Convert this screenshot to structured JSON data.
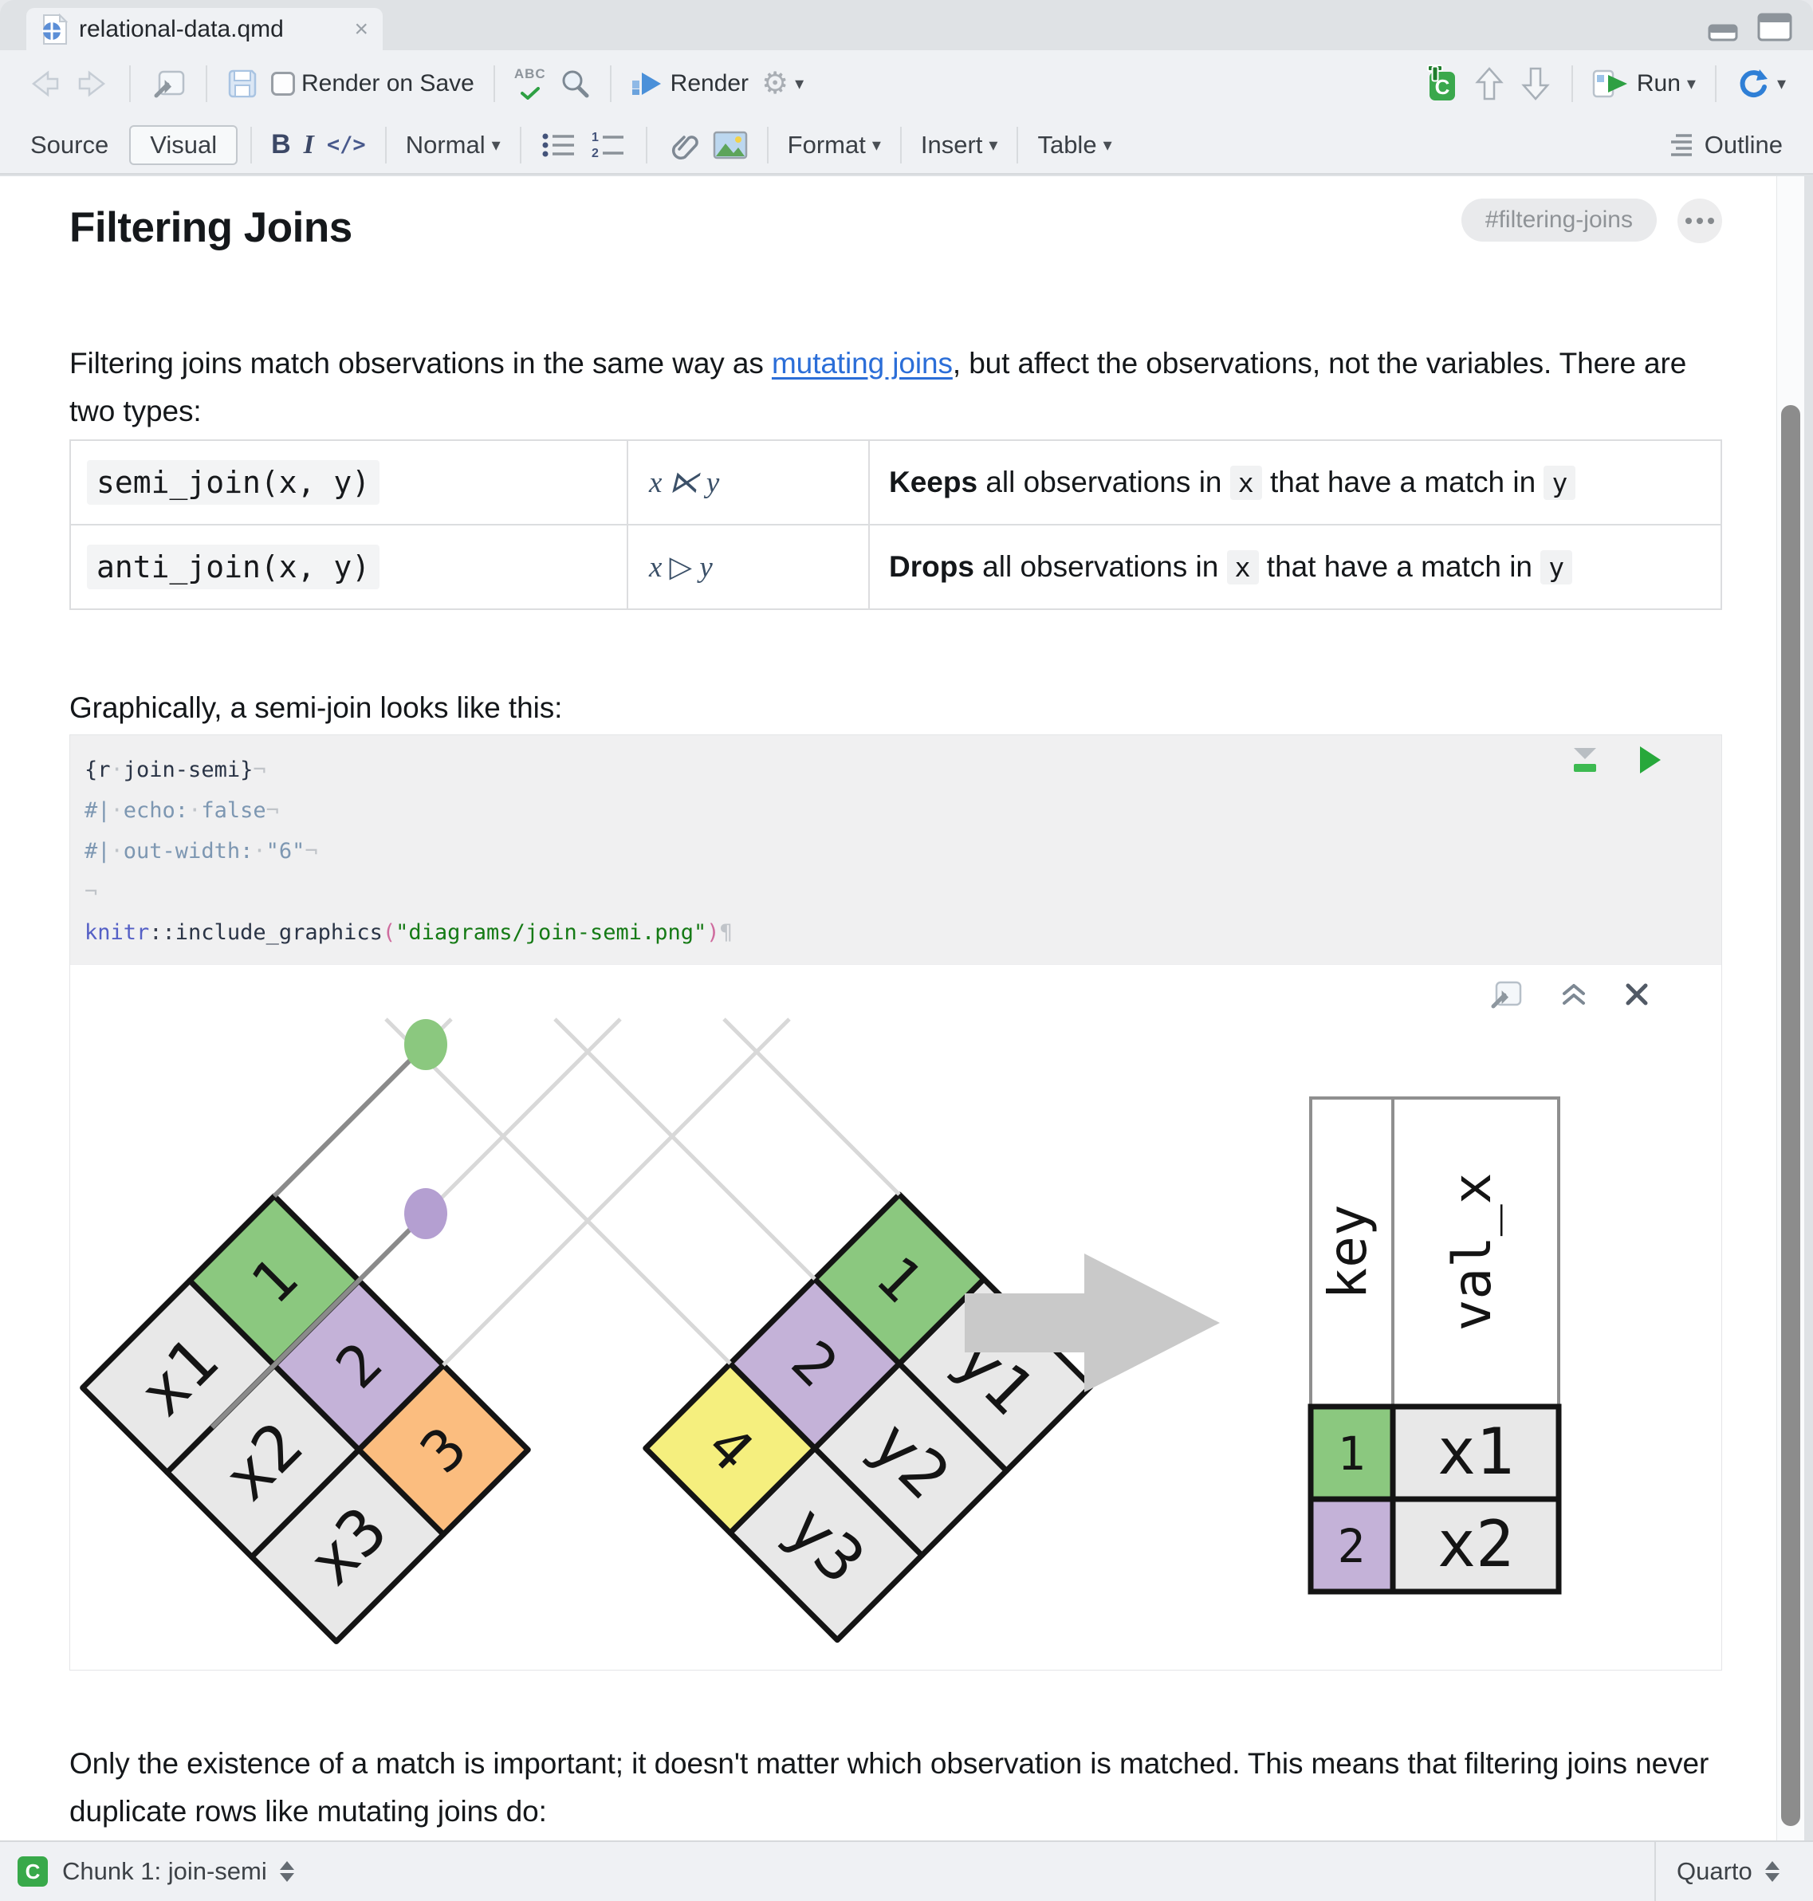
{
  "window": {
    "tab_title": "relational-data.qmd",
    "close_icon": "×"
  },
  "toolbar": {
    "render_on_save": "Render on Save",
    "spell_abc": "ABC",
    "render": "Render",
    "run": "Run",
    "caret": "▾"
  },
  "formatbar": {
    "source": "Source",
    "visual": "Visual",
    "bold": "B",
    "italic": "I",
    "code": "</>",
    "block_format": "Normal",
    "format_menu": "Format",
    "insert_menu": "Insert",
    "table_menu": "Table",
    "outline": "Outline"
  },
  "doc": {
    "heading": "Filtering Joins",
    "section_badge": "#filtering-joins",
    "para1_pre": "Filtering joins match observations in the same way as ",
    "para1_link": "mutating joins",
    "para1_post": ", but affect the observations, not the variables. There are two types:",
    "join_table": {
      "rows": [
        {
          "code": "semi_join(x, y)",
          "math": "x ⋉ y",
          "bold": "Keeps",
          "mid1": " all observations in ",
          "arg1": "x",
          "mid2": " that have a match in ",
          "arg2": "y"
        },
        {
          "code": "anti_join(x, y)",
          "math": "x ▷ y",
          "bold": "Drops",
          "mid1": " all observations in ",
          "arg1": "x",
          "mid2": " that have a match in ",
          "arg2": "y"
        }
      ]
    },
    "para2": "Graphically, a semi-join looks like this:",
    "chunk": {
      "dot": "·",
      "nl": "¬",
      "pilcrow": "¶",
      "l1_a": "{r",
      "l1_b": "join-semi}",
      "l2_a": "#|",
      "l2_b": "echo:",
      "l2_c": "false",
      "l3_a": "#|",
      "l3_b": "out-width:",
      "l3_c": "\"6\"",
      "l5_pkg": "knitr",
      "l5_colons": "::",
      "l5_fn": "include_graphics",
      "l5_open": "(",
      "l5_str": "\"diagrams/join-semi.png\"",
      "l5_close": ")"
    },
    "para3_line1": "Only the existence of a match is important; it doesn't matter which observation is matched. This means",
    "para3_line2": "that filtering joins never duplicate rows like mutating joins do:"
  },
  "diagram": {
    "cell_gray": "#e8e8e8",
    "dot_green": "#8bc87f",
    "dot_purple": "#b49fd1",
    "x_table": {
      "vals": [
        "x1",
        "x2",
        "x3"
      ],
      "keys": [
        "1",
        "2",
        "3"
      ],
      "key_colors": [
        "#8bc87f",
        "#c4b2d8",
        "#fbbd7f"
      ]
    },
    "y_table": {
      "keys": [
        "1",
        "2",
        "4"
      ],
      "key_colors": [
        "#8bc87f",
        "#c4b2d8",
        "#f5ef7e"
      ],
      "vals": [
        "y1",
        "y2",
        "y3"
      ]
    },
    "result_table": {
      "headers": [
        "key",
        "val_x"
      ],
      "rows": [
        {
          "key": "1",
          "val": "x1",
          "key_color": "#8bc87f"
        },
        {
          "key": "2",
          "val": "x2",
          "key_color": "#c4b2d8"
        }
      ]
    }
  },
  "statusbar": {
    "chunk_badge": "C",
    "chunk_label": "Chunk 1: join-semi",
    "mode": "Quarto"
  }
}
